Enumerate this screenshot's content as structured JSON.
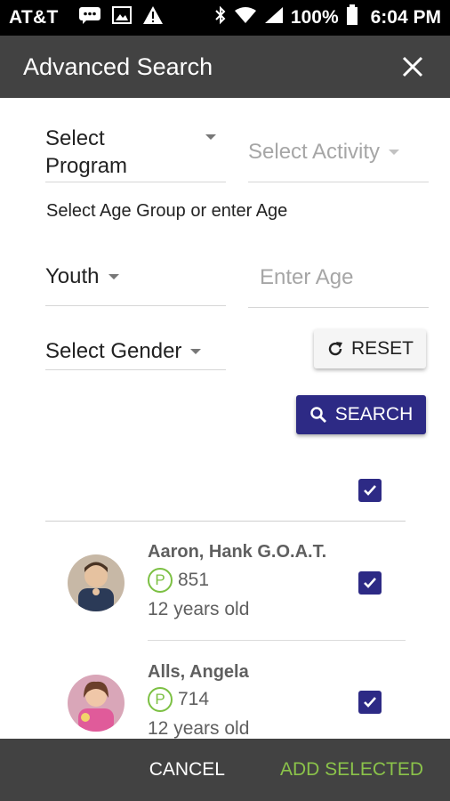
{
  "status_bar": {
    "carrier": "AT&T",
    "notification_icons": [
      "message-icon",
      "image-icon",
      "alert-icon"
    ],
    "system_icons": [
      "bluetooth-icon",
      "wifi-icon",
      "signal-icon"
    ],
    "battery": "100%",
    "time": "6:04 PM"
  },
  "app_bar": {
    "title": "Advanced Search",
    "close_icon": "close-icon"
  },
  "filters": {
    "program_placeholder": "Select Program",
    "activity_placeholder": "Select Activity",
    "age_group_label": "Select Age Group or enter Age",
    "age_group_value": "Youth",
    "age_placeholder": "Enter Age",
    "gender_placeholder": "Select Gender",
    "reset_label": "RESET",
    "search_label": "SEARCH"
  },
  "select_all_checked": true,
  "results": [
    {
      "name": "Aaron, Hank G.O.A.T.",
      "points": "851",
      "age": "12 years old",
      "checked": true
    },
    {
      "name": "Alls, Angela",
      "points": "714",
      "age": "12 years old",
      "checked": true
    }
  ],
  "footer": {
    "cancel_label": "CANCEL",
    "add_selected_label": "ADD SELECTED"
  },
  "colors": {
    "app_bar": "#424242",
    "primary": "#2d2a85",
    "accent_green": "#8bc34a"
  }
}
